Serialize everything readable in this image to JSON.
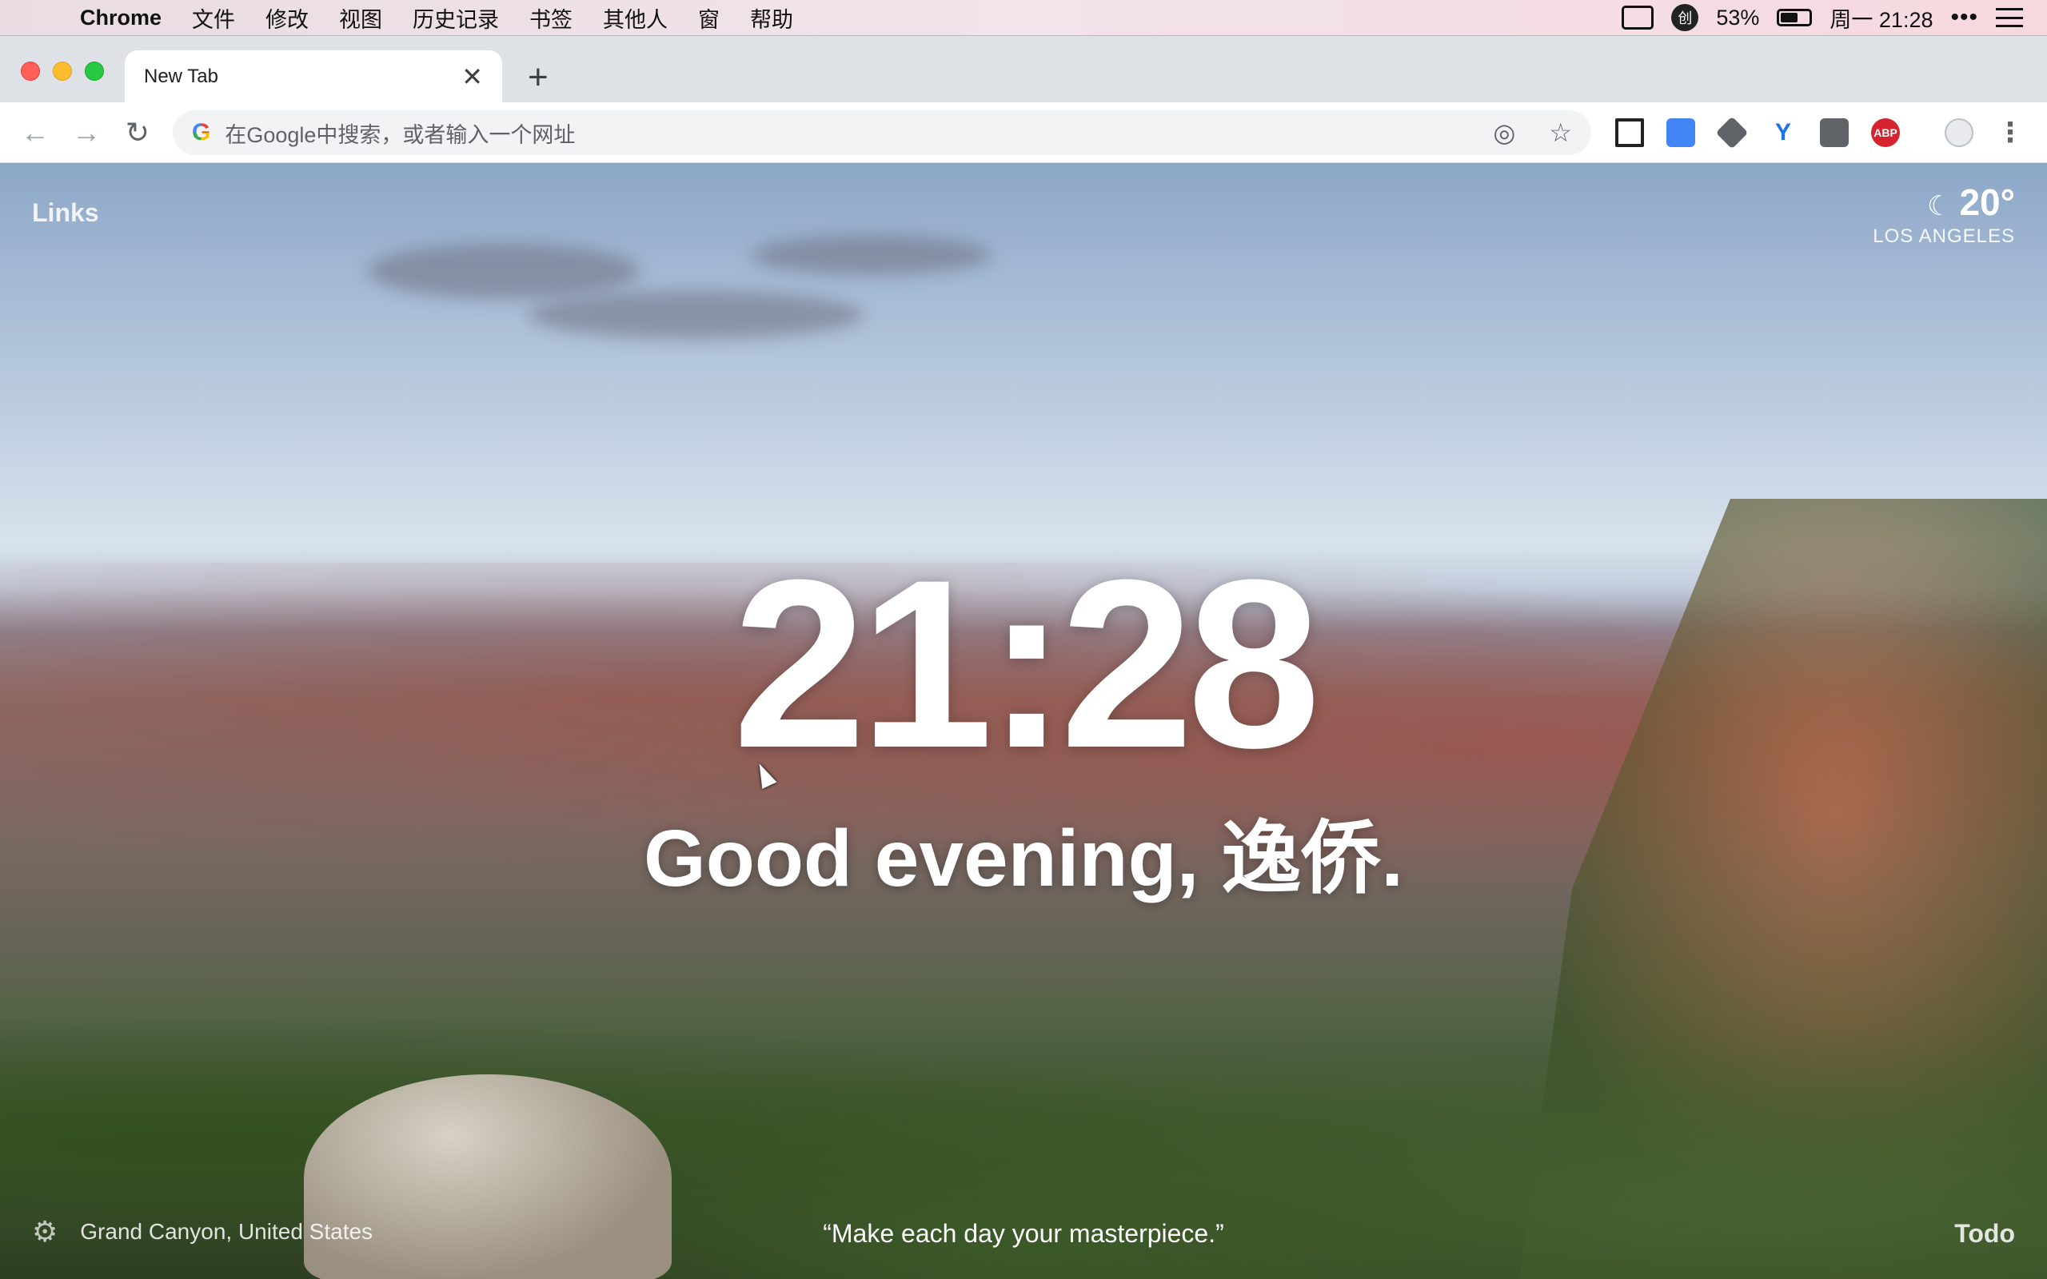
{
  "menubar": {
    "app_name": "Chrome",
    "menus": [
      "文件",
      "修改",
      "视图",
      "历史记录",
      "书签",
      "其他人",
      "窗",
      "帮助"
    ],
    "badge": "创",
    "battery": "53%",
    "battery_level": 0.53,
    "datetime": "周一 21:28",
    "icons": [
      "apple-icon",
      "camera-icon",
      "ime-icon",
      "battery-icon",
      "more-icon",
      "list-icon"
    ]
  },
  "tab": {
    "title": "New Tab",
    "close_glyph": "✕",
    "new_glyph": "+"
  },
  "toolbar": {
    "back_glyph": "←",
    "forward_glyph": "→",
    "reload_glyph": "↻",
    "omnibox_placeholder": "在Google中搜索，或者输入一个网址",
    "google_glyph": "G",
    "location_glyph": "◎",
    "star_glyph": "☆",
    "abp_label": "ABP",
    "menu_glyph": "⋮"
  },
  "momentum": {
    "links": "Links",
    "weather_temp": "20°",
    "weather_city": "LOS ANGELES",
    "moon_glyph": "☾",
    "clock": "21:28",
    "greeting": "Good evening, 逸侨.",
    "location": "Grand Canyon, United States",
    "quote": "“Make each day your masterpiece.”",
    "todo": "Todo",
    "gear_glyph": "⚙"
  },
  "colors": {
    "traffic_red": "#fe5f57",
    "traffic_yellow": "#febc2e",
    "traffic_green": "#28c840",
    "abp_red": "#d5232f"
  }
}
